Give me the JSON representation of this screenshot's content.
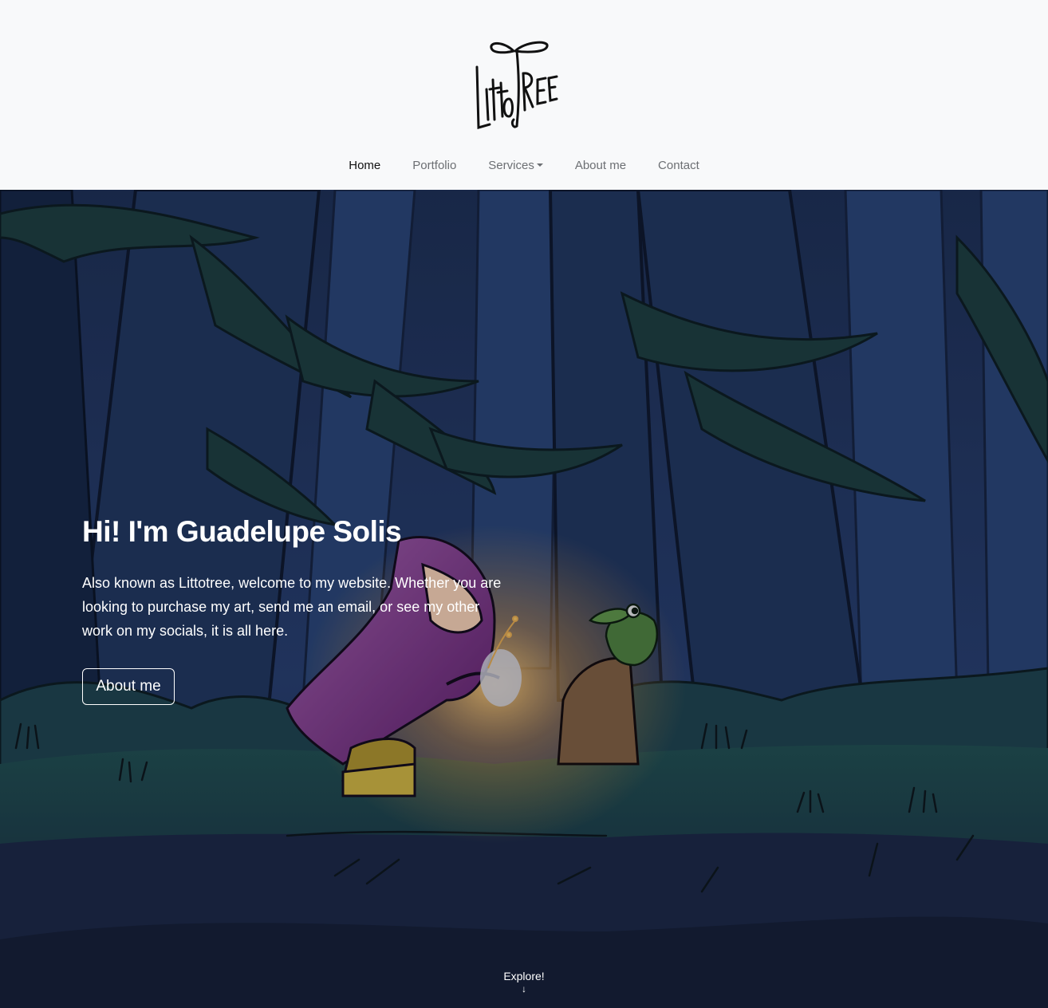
{
  "logo": {
    "text": "LittoTREE",
    "alt": "Littotree logo"
  },
  "nav": {
    "items": [
      {
        "label": "Home",
        "active": true
      },
      {
        "label": "Portfolio",
        "active": false
      },
      {
        "label": "Services",
        "active": false,
        "dropdown": true
      },
      {
        "label": "About me",
        "active": false
      },
      {
        "label": "Contact",
        "active": false
      }
    ]
  },
  "hero": {
    "title": "Hi! I'm Guadelupe Solis",
    "text": "Also known as Littotree, welcome to my website. Whether you are looking to purchase my art, send me an email, or see my other work on my socials, it is all here.",
    "button_label": "About me",
    "explore_label": "Explore!",
    "explore_arrow": "↓"
  },
  "colors": {
    "header_bg": "#f8f9fa",
    "nav_active": "#111111",
    "nav_inactive": "#6c6f73",
    "hero_sky": "#1e2f52",
    "hero_text": "#ffffff"
  }
}
